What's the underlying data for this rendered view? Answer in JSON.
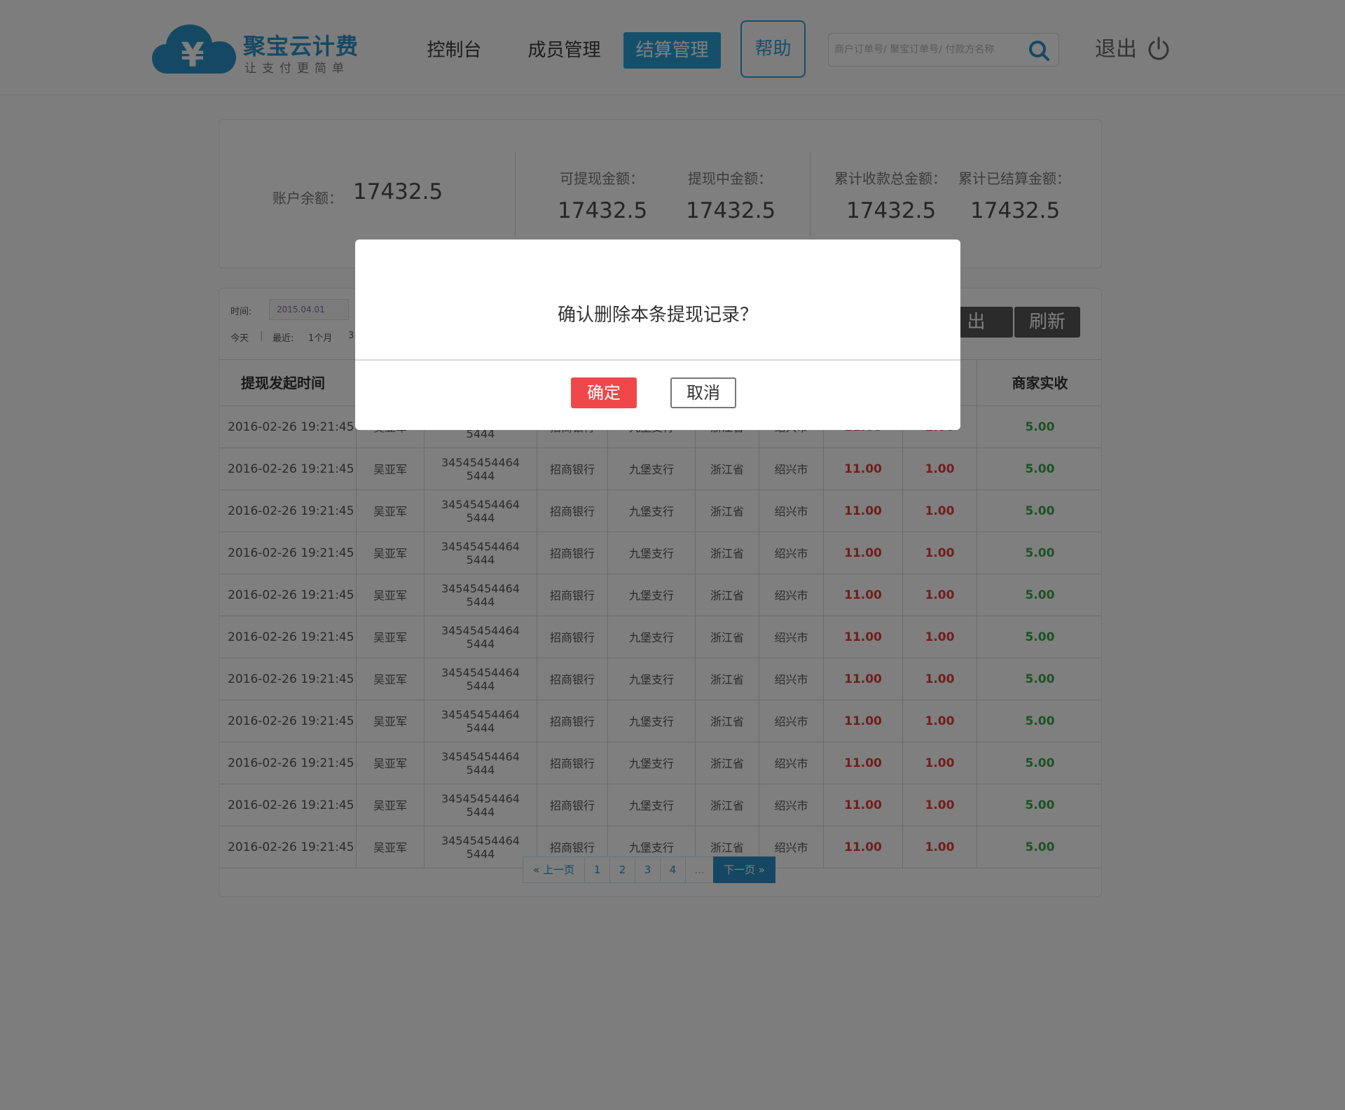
{
  "header": {
    "brand": "聚宝云计费",
    "slogan": "让支付更简单",
    "nav": {
      "console": "控制台",
      "members": "成员管理",
      "settlement": "结算管理",
      "help": "帮助"
    },
    "search_placeholder": "商户订单号/ 聚宝订单号/ 付款方名称",
    "logout": "退出"
  },
  "summary": {
    "balance_label": "账户余额：",
    "balance": "17432.5",
    "withdrawable_label": "可提现金额：",
    "withdrawable": "17432.5",
    "withdrawing_label": "提现中金额：",
    "withdrawing": "17432.5",
    "total_received_label": "累计收款总金额：",
    "total_received": "17432.5",
    "total_settled_label": "累计已结算金额：",
    "total_settled": "17432.5"
  },
  "filters": {
    "time_label": "时间:",
    "date_value": "2015.04.01",
    "today": "今天",
    "separator": "|",
    "recent_label": "最近:",
    "one_month": "1个月",
    "three_prefix": "3",
    "export_partial": "出",
    "refresh": "刷新"
  },
  "table": {
    "headers": {
      "time": "提现发起时间",
      "merchant_received": "商家实收"
    },
    "rows": [
      {
        "time": "2016-02-26 19:21:45",
        "name": "吴亚军",
        "acct1": "34545454464",
        "acct2": "5444",
        "bank": "招商银行",
        "branch": "九堡支行",
        "province": "浙江省",
        "city": "绍兴市",
        "amount": "11.00",
        "fee": "1.00",
        "received": "5.00"
      },
      {
        "time": "2016-02-26 19:21:45",
        "name": "吴亚军",
        "acct1": "34545454464",
        "acct2": "5444",
        "bank": "招商银行",
        "branch": "九堡支行",
        "province": "浙江省",
        "city": "绍兴市",
        "amount": "11.00",
        "fee": "1.00",
        "received": "5.00"
      },
      {
        "time": "2016-02-26 19:21:45",
        "name": "吴亚军",
        "acct1": "34545454464",
        "acct2": "5444",
        "bank": "招商银行",
        "branch": "九堡支行",
        "province": "浙江省",
        "city": "绍兴市",
        "amount": "11.00",
        "fee": "1.00",
        "received": "5.00"
      },
      {
        "time": "2016-02-26 19:21:45",
        "name": "吴亚军",
        "acct1": "34545454464",
        "acct2": "5444",
        "bank": "招商银行",
        "branch": "九堡支行",
        "province": "浙江省",
        "city": "绍兴市",
        "amount": "11.00",
        "fee": "1.00",
        "received": "5.00"
      },
      {
        "time": "2016-02-26 19:21:45",
        "name": "吴亚军",
        "acct1": "34545454464",
        "acct2": "5444",
        "bank": "招商银行",
        "branch": "九堡支行",
        "province": "浙江省",
        "city": "绍兴市",
        "amount": "11.00",
        "fee": "1.00",
        "received": "5.00"
      },
      {
        "time": "2016-02-26 19:21:45",
        "name": "吴亚军",
        "acct1": "34545454464",
        "acct2": "5444",
        "bank": "招商银行",
        "branch": "九堡支行",
        "province": "浙江省",
        "city": "绍兴市",
        "amount": "11.00",
        "fee": "1.00",
        "received": "5.00"
      },
      {
        "time": "2016-02-26 19:21:45",
        "name": "吴亚军",
        "acct1": "34545454464",
        "acct2": "5444",
        "bank": "招商银行",
        "branch": "九堡支行",
        "province": "浙江省",
        "city": "绍兴市",
        "amount": "11.00",
        "fee": "1.00",
        "received": "5.00"
      },
      {
        "time": "2016-02-26 19:21:45",
        "name": "吴亚军",
        "acct1": "34545454464",
        "acct2": "5444",
        "bank": "招商银行",
        "branch": "九堡支行",
        "province": "浙江省",
        "city": "绍兴市",
        "amount": "11.00",
        "fee": "1.00",
        "received": "5.00"
      },
      {
        "time": "2016-02-26 19:21:45",
        "name": "吴亚军",
        "acct1": "34545454464",
        "acct2": "5444",
        "bank": "招商银行",
        "branch": "九堡支行",
        "province": "浙江省",
        "city": "绍兴市",
        "amount": "11.00",
        "fee": "1.00",
        "received": "5.00"
      },
      {
        "time": "2016-02-26 19:21:45",
        "name": "吴亚军",
        "acct1": "34545454464",
        "acct2": "5444",
        "bank": "招商银行",
        "branch": "九堡支行",
        "province": "浙江省",
        "city": "绍兴市",
        "amount": "11.00",
        "fee": "1.00",
        "received": "5.00"
      },
      {
        "time": "2016-02-26 19:21:45",
        "name": "吴亚军",
        "acct1": "34545454464",
        "acct2": "5444",
        "bank": "招商银行",
        "branch": "九堡支行",
        "province": "浙江省",
        "city": "绍兴市",
        "amount": "11.00",
        "fee": "1.00",
        "received": "5.00"
      }
    ]
  },
  "pagination": {
    "prev": "« 上一页",
    "pages": [
      "1",
      "2",
      "3",
      "4",
      "..."
    ],
    "next": "下一页 »"
  },
  "modal": {
    "message": "确认删除本条提现记录？",
    "confirm": "确定",
    "cancel": "取消"
  },
  "colors": {
    "accent": "#2aa0d7",
    "danger": "#f0474a",
    "amount_red": "#e33b3b",
    "received_green": "#3aa54a"
  },
  "icons": {
    "logo": "yen-cloud-icon",
    "search": "search-icon",
    "logout": "power-icon"
  }
}
